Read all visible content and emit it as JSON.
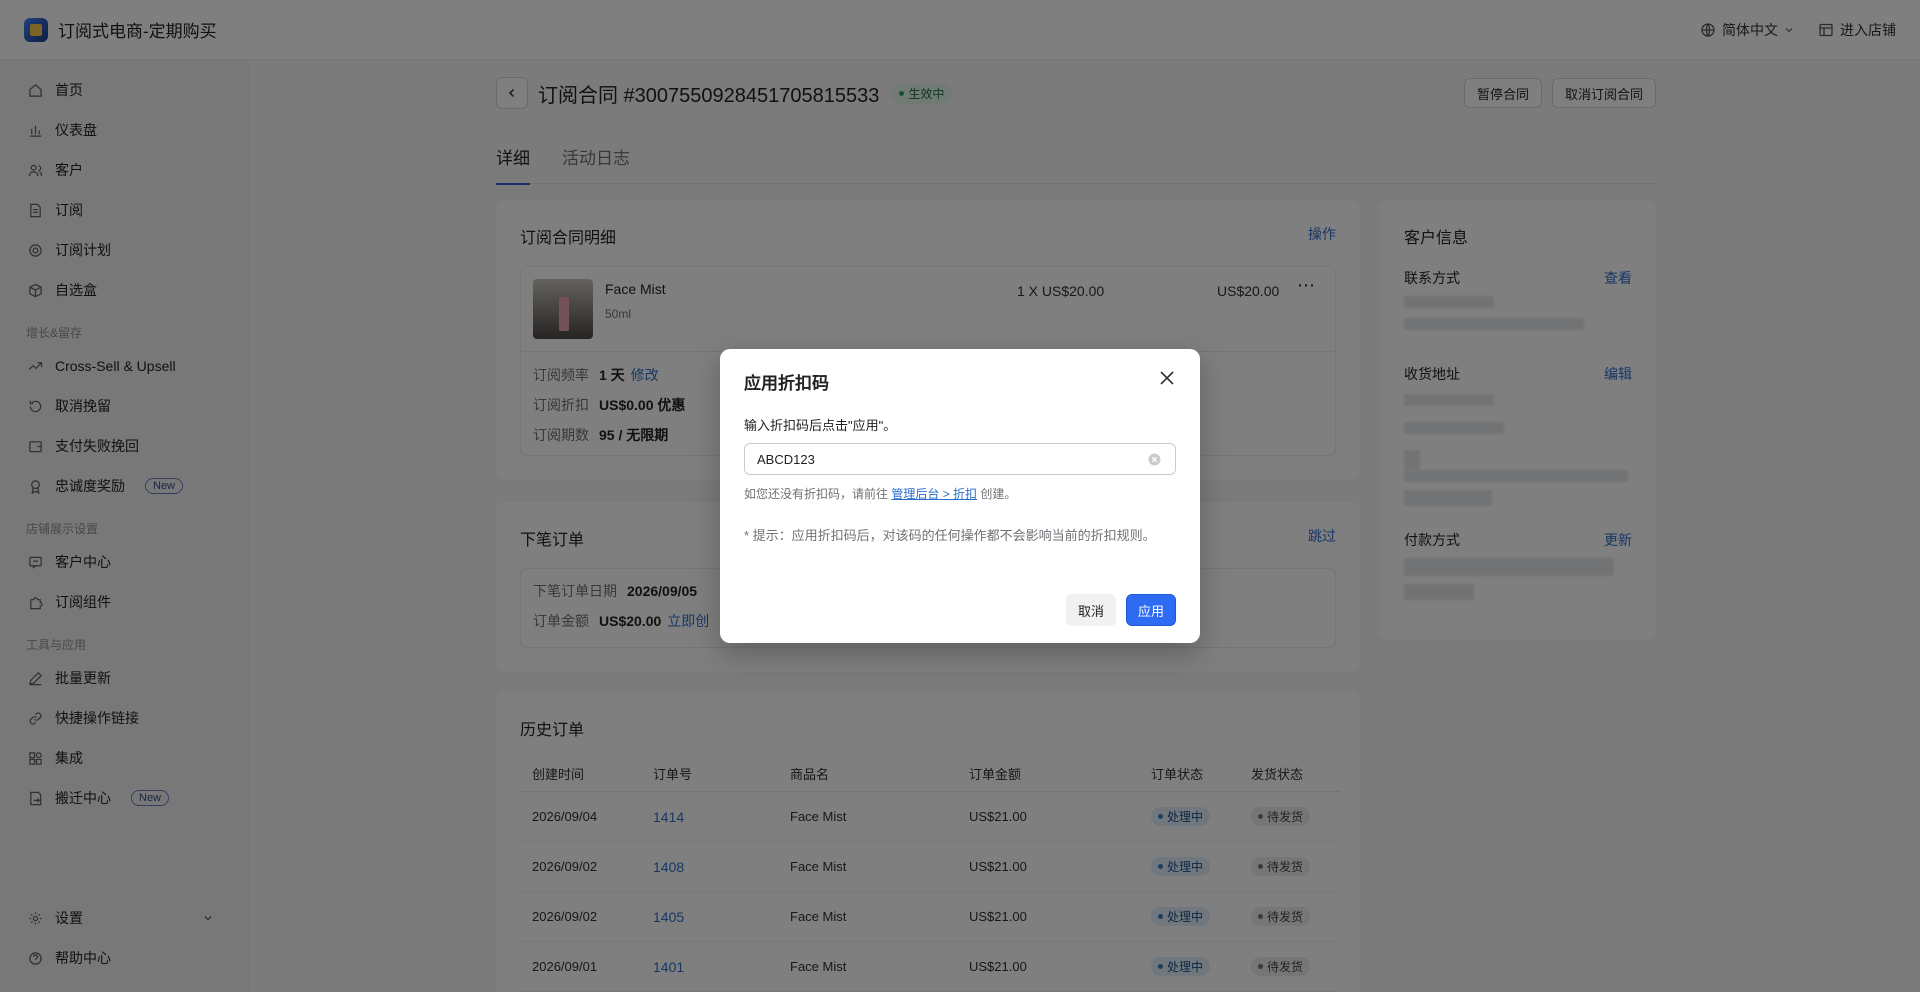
{
  "app": {
    "title": "订阅式电商-定期购买",
    "language": "简体中文",
    "enter_store": "进入店铺"
  },
  "sidebar": {
    "items": [
      {
        "label": "首页",
        "icon": "home-icon"
      },
      {
        "label": "仪表盘",
        "icon": "bar-chart-icon"
      },
      {
        "label": "客户",
        "icon": "users-icon"
      },
      {
        "label": "订阅",
        "icon": "document-icon"
      },
      {
        "label": "订阅计划",
        "icon": "plan-icon"
      },
      {
        "label": "自选盒",
        "icon": "box-icon"
      }
    ],
    "group_growth": "增长&留存",
    "growth_items": [
      {
        "label": "Cross-Sell & Upsell",
        "icon": "trend-icon"
      },
      {
        "label": "取消挽留",
        "icon": "refresh-icon"
      },
      {
        "label": "支付失败挽回",
        "icon": "wallet-icon"
      },
      {
        "label": "忠诚度奖励",
        "icon": "award-icon",
        "badge": "New"
      }
    ],
    "group_store": "店铺展示设置",
    "store_items": [
      {
        "label": "客户中心",
        "icon": "message-icon"
      },
      {
        "label": "订阅组件",
        "icon": "puzzle-icon"
      }
    ],
    "group_tools": "工具与应用",
    "tool_items": [
      {
        "label": "批量更新",
        "icon": "edit-icon"
      },
      {
        "label": "快捷操作链接",
        "icon": "link-icon"
      },
      {
        "label": "集成",
        "icon": "apps-icon"
      },
      {
        "label": "搬迁中心",
        "icon": "migrate-icon",
        "badge": "New"
      }
    ],
    "settings": "设置",
    "help": "帮助中心"
  },
  "contract": {
    "title": "订阅合同 #3007550928451705815533",
    "status": "生效中",
    "pause_btn": "暂停合同",
    "cancel_btn": "取消订阅合同",
    "tabs": [
      "详细",
      "活动日志"
    ]
  },
  "details": {
    "title": "订阅合同明细",
    "action": "操作",
    "product": {
      "name": "Face Mist",
      "variant": "50ml",
      "qty_price": "1 X US$20.00",
      "total": "US$20.00"
    },
    "freq_label": "订阅频率",
    "freq_value": "1 天",
    "freq_edit": "修改",
    "discount_label": "订阅折扣",
    "discount_value": "US$0.00 优惠",
    "periods_label": "订阅期数",
    "periods_value": "95 / 无限期"
  },
  "next_order": {
    "title": "下笔订单",
    "skip": "跳过",
    "date_label": "下笔订单日期",
    "date_value": "2026/09/05",
    "amount_label": "订单金额",
    "amount_value": "US$20.00",
    "create_now": "立即创"
  },
  "history": {
    "title": "历史订单",
    "columns": [
      "创建时间",
      "订单号",
      "商品名",
      "订单金额",
      "订单状态",
      "发货状态"
    ],
    "rows": [
      {
        "date": "2026/09/04",
        "order": "1414",
        "product": "Face Mist",
        "amount": "US$21.00",
        "status": "处理中",
        "ship": "待发货"
      },
      {
        "date": "2026/09/02",
        "order": "1408",
        "product": "Face Mist",
        "amount": "US$21.00",
        "status": "处理中",
        "ship": "待发货"
      },
      {
        "date": "2026/09/02",
        "order": "1405",
        "product": "Face Mist",
        "amount": "US$21.00",
        "status": "处理中",
        "ship": "待发货"
      },
      {
        "date": "2026/09/01",
        "order": "1401",
        "product": "Face Mist",
        "amount": "US$21.00",
        "status": "处理中",
        "ship": "待发货"
      }
    ]
  },
  "customer": {
    "title": "客户信息",
    "contact": "联系方式",
    "contact_link": "查看",
    "address": "收货地址",
    "address_link": "编辑",
    "payment": "付款方式",
    "payment_link": "更新"
  },
  "modal": {
    "title": "应用折扣码",
    "desc": "输入折扣码后点击\"应用\"。",
    "code_value": "ABCD123",
    "hint_prefix": "如您还没有折扣码，请前往",
    "hint_link": "管理后台 > 折扣",
    "hint_suffix": "创建。",
    "tip": "* 提示：应用折扣码后，对该码的任何操作都不会影响当前的折扣规则。",
    "cancel": "取消",
    "apply": "应用"
  }
}
